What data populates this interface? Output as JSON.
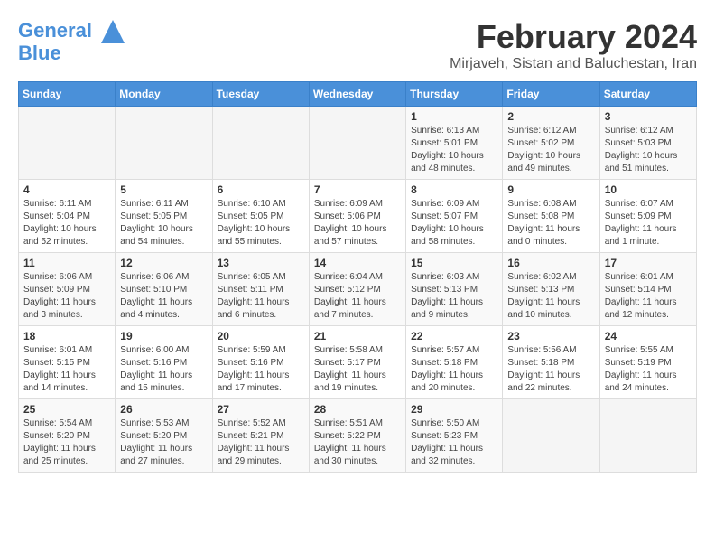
{
  "header": {
    "logo_line1": "General",
    "logo_line2": "Blue",
    "month_title": "February 2024",
    "location": "Mirjaveh, Sistan and Baluchestan, Iran"
  },
  "days_of_week": [
    "Sunday",
    "Monday",
    "Tuesday",
    "Wednesday",
    "Thursday",
    "Friday",
    "Saturday"
  ],
  "weeks": [
    [
      {
        "day": "",
        "info": ""
      },
      {
        "day": "",
        "info": ""
      },
      {
        "day": "",
        "info": ""
      },
      {
        "day": "",
        "info": ""
      },
      {
        "day": "1",
        "info": "Sunrise: 6:13 AM\nSunset: 5:01 PM\nDaylight: 10 hours\nand 48 minutes."
      },
      {
        "day": "2",
        "info": "Sunrise: 6:12 AM\nSunset: 5:02 PM\nDaylight: 10 hours\nand 49 minutes."
      },
      {
        "day": "3",
        "info": "Sunrise: 6:12 AM\nSunset: 5:03 PM\nDaylight: 10 hours\nand 51 minutes."
      }
    ],
    [
      {
        "day": "4",
        "info": "Sunrise: 6:11 AM\nSunset: 5:04 PM\nDaylight: 10 hours\nand 52 minutes."
      },
      {
        "day": "5",
        "info": "Sunrise: 6:11 AM\nSunset: 5:05 PM\nDaylight: 10 hours\nand 54 minutes."
      },
      {
        "day": "6",
        "info": "Sunrise: 6:10 AM\nSunset: 5:05 PM\nDaylight: 10 hours\nand 55 minutes."
      },
      {
        "day": "7",
        "info": "Sunrise: 6:09 AM\nSunset: 5:06 PM\nDaylight: 10 hours\nand 57 minutes."
      },
      {
        "day": "8",
        "info": "Sunrise: 6:09 AM\nSunset: 5:07 PM\nDaylight: 10 hours\nand 58 minutes."
      },
      {
        "day": "9",
        "info": "Sunrise: 6:08 AM\nSunset: 5:08 PM\nDaylight: 11 hours\nand 0 minutes."
      },
      {
        "day": "10",
        "info": "Sunrise: 6:07 AM\nSunset: 5:09 PM\nDaylight: 11 hours\nand 1 minute."
      }
    ],
    [
      {
        "day": "11",
        "info": "Sunrise: 6:06 AM\nSunset: 5:09 PM\nDaylight: 11 hours\nand 3 minutes."
      },
      {
        "day": "12",
        "info": "Sunrise: 6:06 AM\nSunset: 5:10 PM\nDaylight: 11 hours\nand 4 minutes."
      },
      {
        "day": "13",
        "info": "Sunrise: 6:05 AM\nSunset: 5:11 PM\nDaylight: 11 hours\nand 6 minutes."
      },
      {
        "day": "14",
        "info": "Sunrise: 6:04 AM\nSunset: 5:12 PM\nDaylight: 11 hours\nand 7 minutes."
      },
      {
        "day": "15",
        "info": "Sunrise: 6:03 AM\nSunset: 5:13 PM\nDaylight: 11 hours\nand 9 minutes."
      },
      {
        "day": "16",
        "info": "Sunrise: 6:02 AM\nSunset: 5:13 PM\nDaylight: 11 hours\nand 10 minutes."
      },
      {
        "day": "17",
        "info": "Sunrise: 6:01 AM\nSunset: 5:14 PM\nDaylight: 11 hours\nand 12 minutes."
      }
    ],
    [
      {
        "day": "18",
        "info": "Sunrise: 6:01 AM\nSunset: 5:15 PM\nDaylight: 11 hours\nand 14 minutes."
      },
      {
        "day": "19",
        "info": "Sunrise: 6:00 AM\nSunset: 5:16 PM\nDaylight: 11 hours\nand 15 minutes."
      },
      {
        "day": "20",
        "info": "Sunrise: 5:59 AM\nSunset: 5:16 PM\nDaylight: 11 hours\nand 17 minutes."
      },
      {
        "day": "21",
        "info": "Sunrise: 5:58 AM\nSunset: 5:17 PM\nDaylight: 11 hours\nand 19 minutes."
      },
      {
        "day": "22",
        "info": "Sunrise: 5:57 AM\nSunset: 5:18 PM\nDaylight: 11 hours\nand 20 minutes."
      },
      {
        "day": "23",
        "info": "Sunrise: 5:56 AM\nSunset: 5:18 PM\nDaylight: 11 hours\nand 22 minutes."
      },
      {
        "day": "24",
        "info": "Sunrise: 5:55 AM\nSunset: 5:19 PM\nDaylight: 11 hours\nand 24 minutes."
      }
    ],
    [
      {
        "day": "25",
        "info": "Sunrise: 5:54 AM\nSunset: 5:20 PM\nDaylight: 11 hours\nand 25 minutes."
      },
      {
        "day": "26",
        "info": "Sunrise: 5:53 AM\nSunset: 5:20 PM\nDaylight: 11 hours\nand 27 minutes."
      },
      {
        "day": "27",
        "info": "Sunrise: 5:52 AM\nSunset: 5:21 PM\nDaylight: 11 hours\nand 29 minutes."
      },
      {
        "day": "28",
        "info": "Sunrise: 5:51 AM\nSunset: 5:22 PM\nDaylight: 11 hours\nand 30 minutes."
      },
      {
        "day": "29",
        "info": "Sunrise: 5:50 AM\nSunset: 5:23 PM\nDaylight: 11 hours\nand 32 minutes."
      },
      {
        "day": "",
        "info": ""
      },
      {
        "day": "",
        "info": ""
      }
    ]
  ]
}
